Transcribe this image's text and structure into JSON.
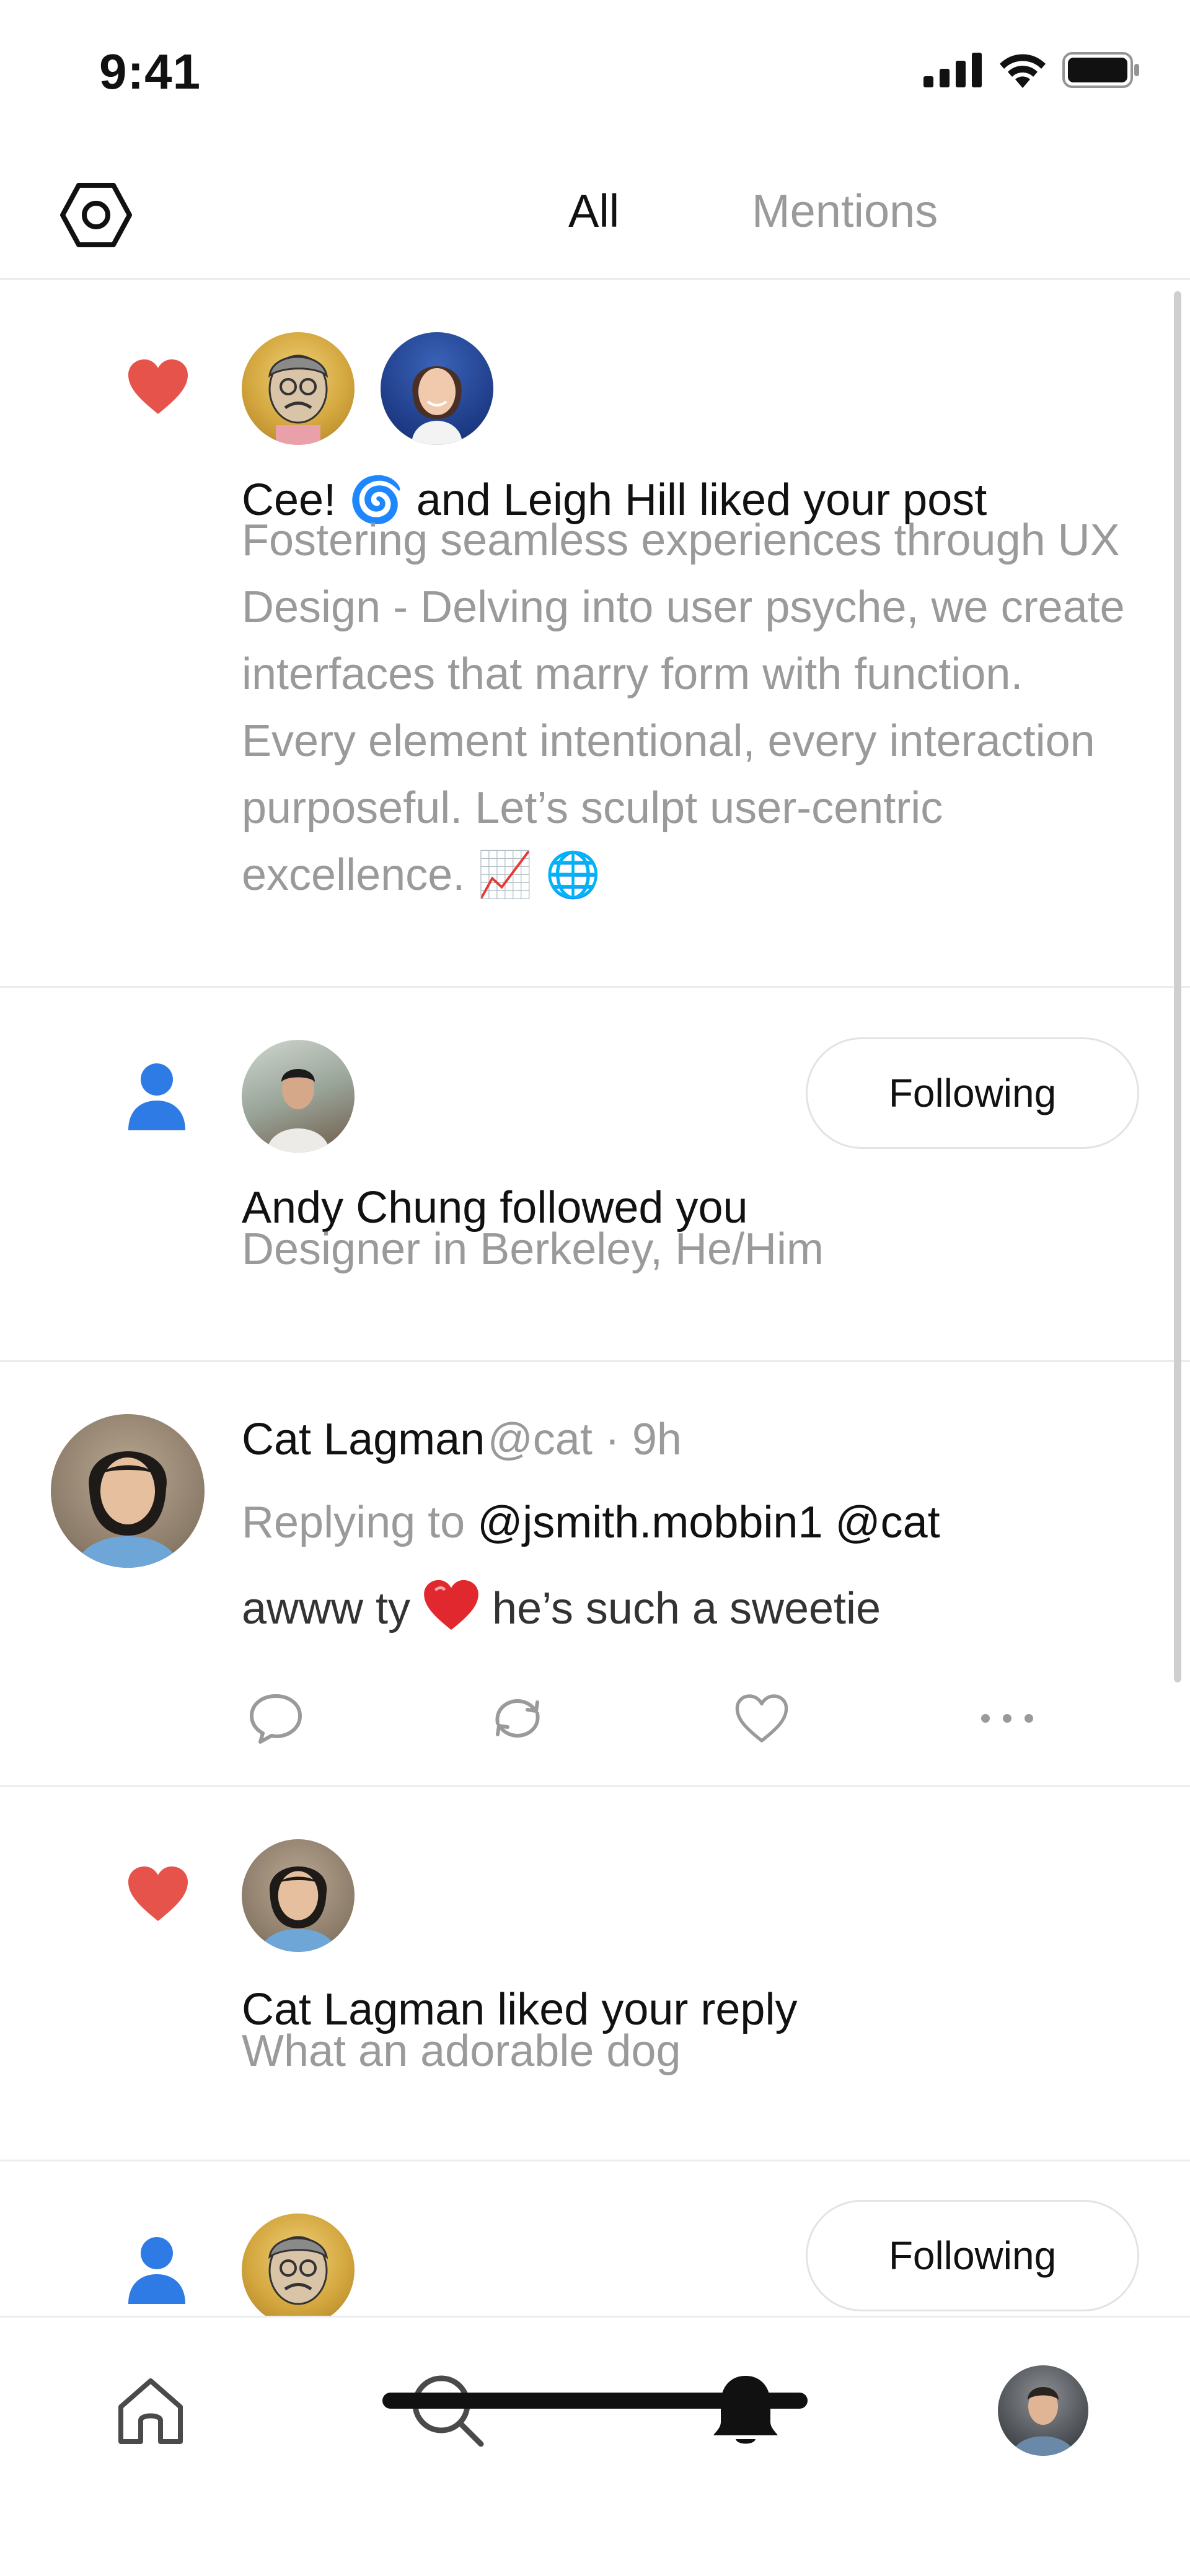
{
  "status_bar": {
    "time": "9:41"
  },
  "header": {
    "settings_icon": "hexagon-settings-icon",
    "tabs": [
      {
        "label": "All",
        "active": true
      },
      {
        "label": "Mentions",
        "active": false
      }
    ]
  },
  "feed": [
    {
      "type": "like",
      "icon": "heart-icon",
      "title": "Cee! 🌀 and Leigh Hill liked your post",
      "body": "Fostering seamless experiences through UX Design - Delving into user psyche, we create interfaces that marry form with function. Every element intentional, every interaction purposeful. Let’s sculpt user-centric excellence. 📈 🌐"
    },
    {
      "type": "follow",
      "icon": "person-icon",
      "title": "Andy Chung followed you",
      "subtitle": "Designer in Berkeley, He/Him",
      "button_label": "Following"
    },
    {
      "type": "reply",
      "name": "Cat Lagman",
      "handle": "@cat · 9h",
      "replying_prefix": "Replying to ",
      "replying_to": "@jsmith.mobbin1 @cat",
      "text_before": "awww ty ",
      "emoji": "❤️",
      "text_after": " he’s such a sweetie",
      "actions": [
        "reply-icon",
        "repost-icon",
        "like-icon",
        "more-icon"
      ]
    },
    {
      "type": "like",
      "icon": "heart-icon",
      "title": "Cat Lagman liked your reply",
      "subtitle": "What an adorable dog"
    },
    {
      "type": "follow",
      "icon": "person-icon",
      "button_label": "Following"
    }
  ],
  "tabbar": {
    "items": [
      "home-icon",
      "search-icon",
      "notifications-bell-icon",
      "profile-avatar"
    ],
    "active": "notifications-bell-icon"
  },
  "colors": {
    "heart": "#E5534B",
    "person": "#2F7BE5",
    "muted_text": "#9A9A9A",
    "reply_heart": "#E0282E"
  }
}
